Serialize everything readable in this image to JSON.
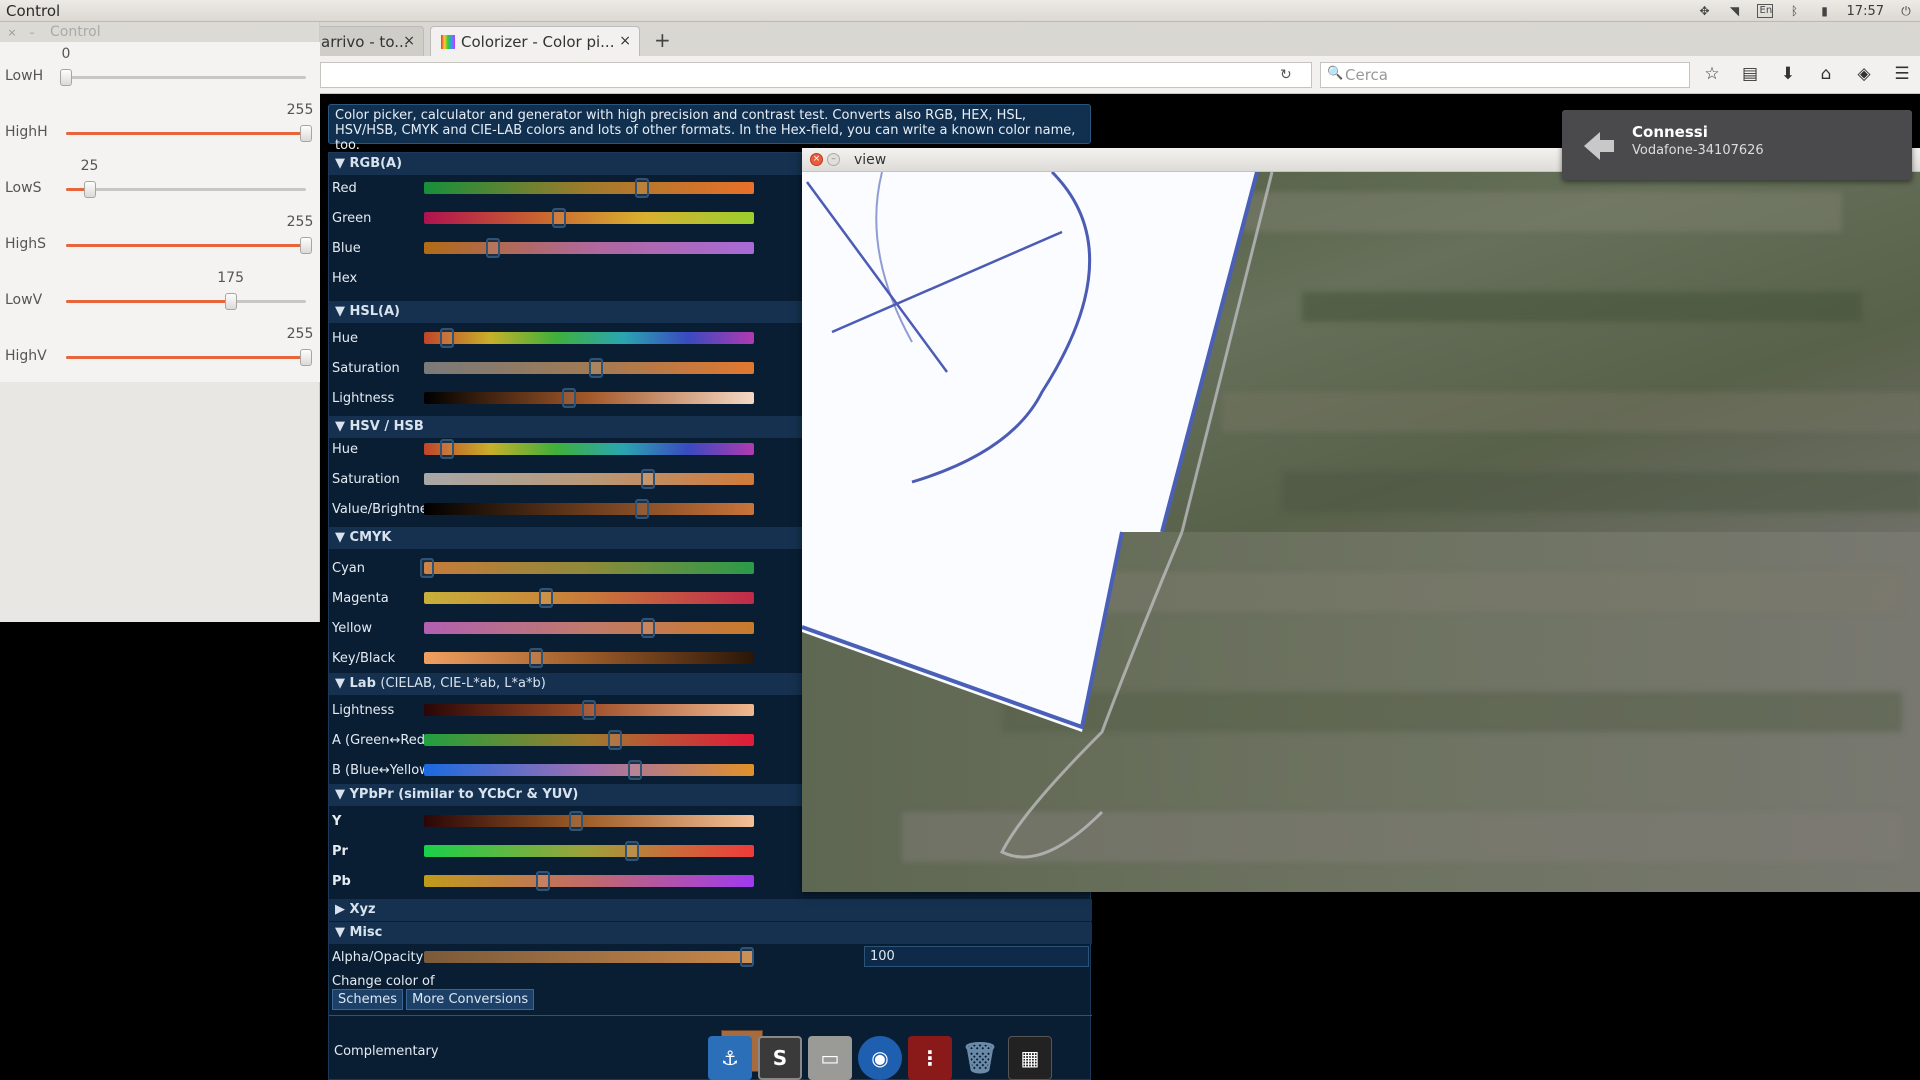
{
  "system": {
    "app_title": "Control",
    "clock": "17:57",
    "lang": "En"
  },
  "browser": {
    "tabs": [
      {
        "label": "arrivo - to..."
      },
      {
        "label": "Colorizer - Color pi..."
      }
    ],
    "search_placeholder": "Cerca"
  },
  "control_window": {
    "title": "Control",
    "trackbars": [
      {
        "label": "LowH",
        "value": "0",
        "fraction": 0.0
      },
      {
        "label": "HighH",
        "value": "255",
        "fraction": 1.0
      },
      {
        "label": "LowS",
        "value": "25",
        "fraction": 0.098
      },
      {
        "label": "HighS",
        "value": "255",
        "fraction": 1.0
      },
      {
        "label": "LowV",
        "value": "175",
        "fraction": 0.686
      },
      {
        "label": "HighV",
        "value": "255",
        "fraction": 1.0
      }
    ]
  },
  "colorizer": {
    "description": "Color picker, calculator and generator with high precision and contrast test. Converts also RGB, HEX, HSL, HSV/HSB, CMYK and CIE-LAB colors and lots of other formats. In the Hex-field, you can write a known color name, too.",
    "sections": {
      "rgb": "▼ RGB(A)",
      "hsl": "▼ HSL(A)",
      "hsv": "▼ HSV / HSB",
      "cmyk": "▼ CMYK",
      "lab": "▼ Lab",
      "lab_sub": "(CIELAB, CIE-L*ab, L*a*b)",
      "ypbpr": "▼ YPbPr (similar to YCbCr & YUV)",
      "xyz": "▶ Xyz",
      "misc": "▼ Misc"
    },
    "rows": {
      "red": "Red",
      "green": "Green",
      "blue": "Blue",
      "hex": "Hex",
      "hsl_hue": "Hue",
      "hsl_sat": "Saturation",
      "hsl_light": "Lightness",
      "hsv_hue": "Hue",
      "hsv_sat": "Saturation",
      "hsv_val": "Value/Brightness",
      "cyan": "Cyan",
      "magenta": "Magenta",
      "yellow": "Yellow",
      "key": "Key/Black",
      "lab_l": "Lightness",
      "lab_a": "A (Green↔Red)",
      "lab_b": "B (Blue↔Yellow)",
      "y": "Y",
      "pr": "Pr",
      "pb": "Pb",
      "alpha": "Alpha/Opacity"
    },
    "alpha_value": "100",
    "change_color_of": "Change color of",
    "bottom_tabs": [
      "Schemes",
      "More Conversions"
    ],
    "complementary": "Complementary",
    "swatch_color": "#a66b3e"
  },
  "view_window": {
    "title": "view"
  },
  "notification": {
    "title": "Connessi",
    "subtitle": "Vodafone-34107626"
  },
  "colors": {
    "accent": "#e8643a",
    "panel": "#0a1e33"
  }
}
